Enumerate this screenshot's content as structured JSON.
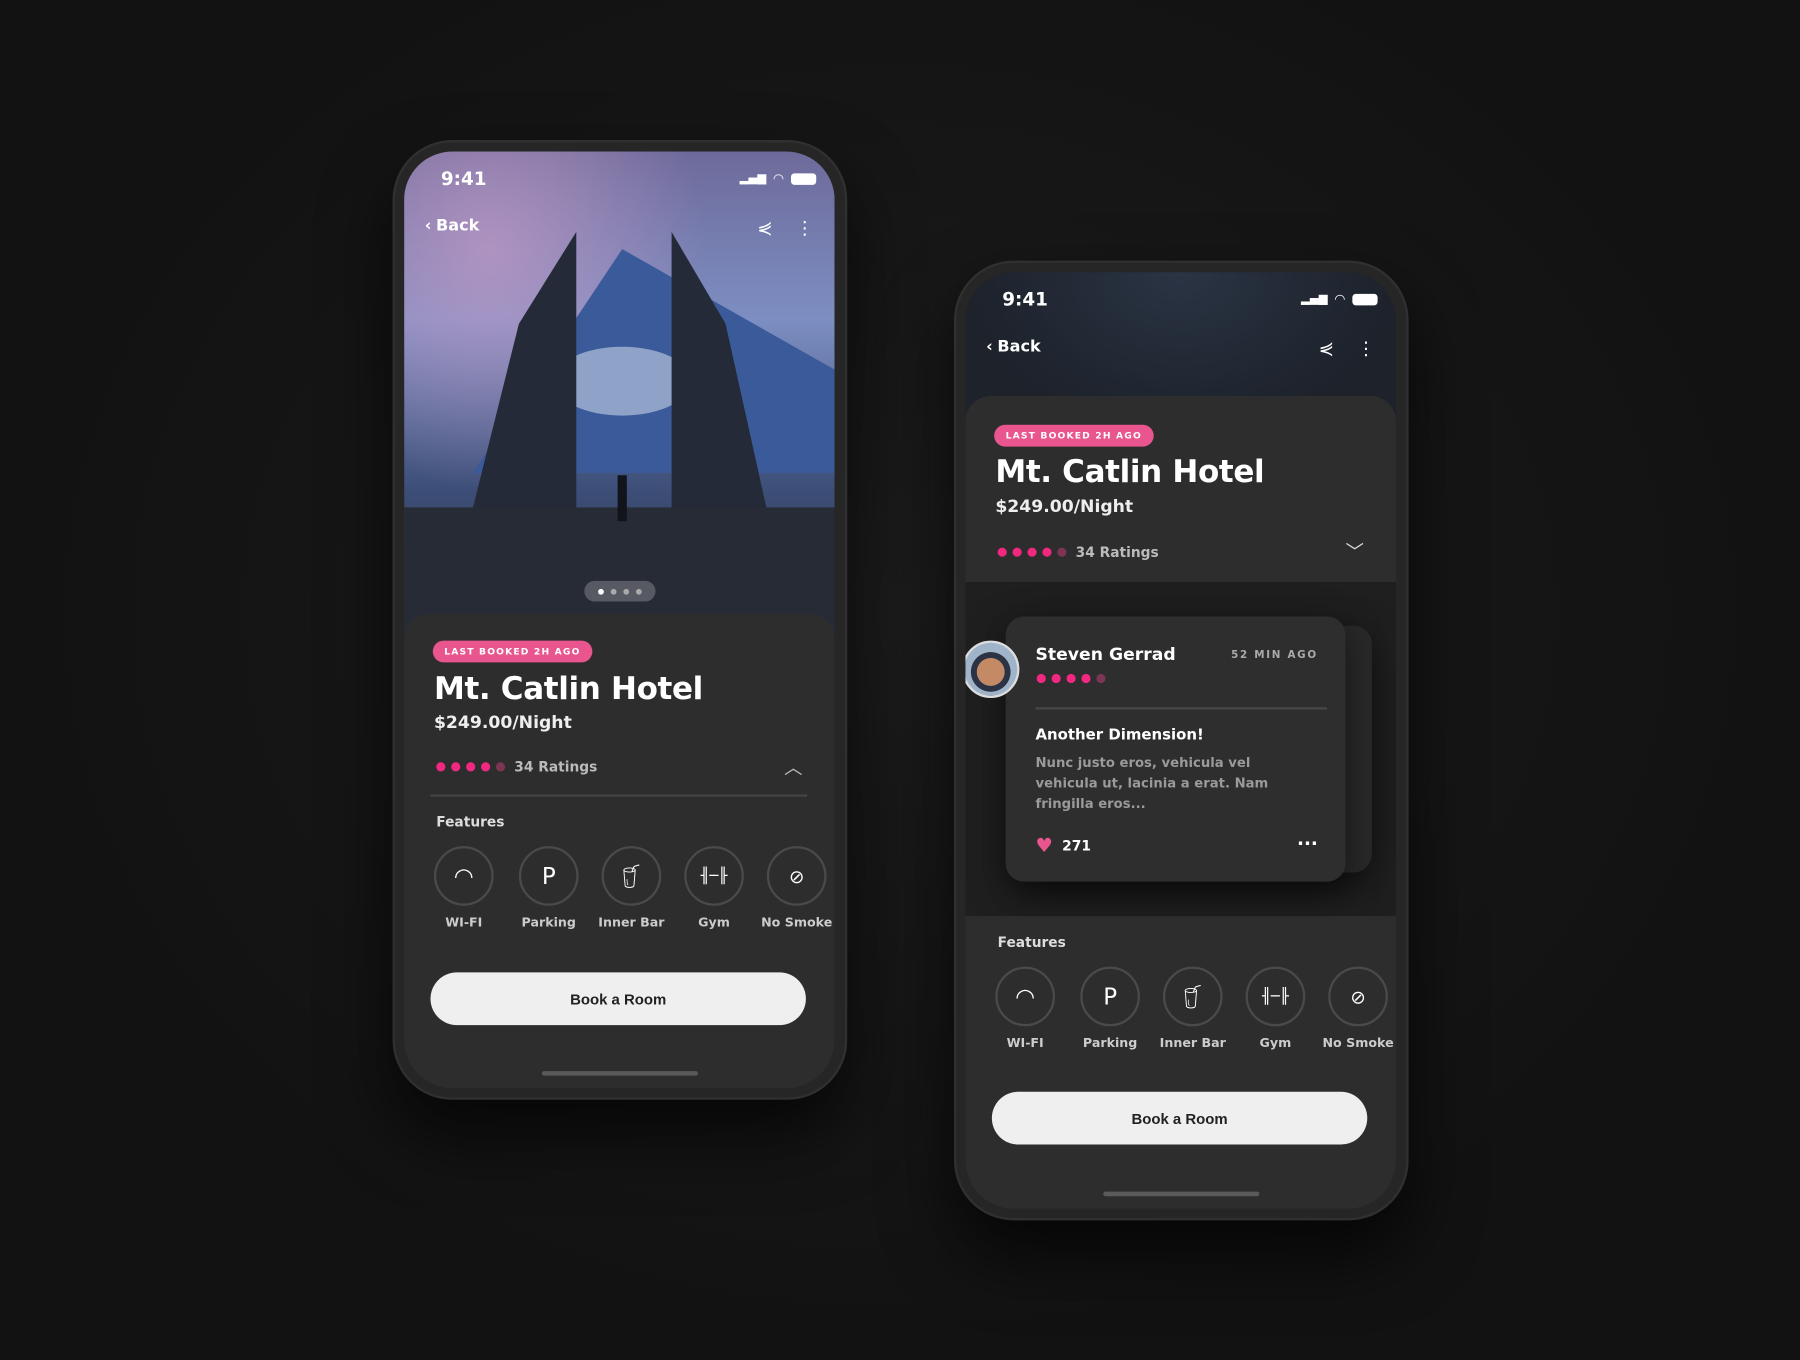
{
  "colors": {
    "accent": "#e8558f",
    "rating_dot": "#f0287f",
    "background": "#141414",
    "sheet": "#2d2d2d",
    "button": "#efefef"
  },
  "status": {
    "time": "9:41",
    "icons": [
      "signal-icon",
      "wifi-icon",
      "battery-icon"
    ]
  },
  "nav": {
    "back": "Back",
    "share_icon": "share-icon",
    "more_icon": "more-vertical-icon"
  },
  "hotel": {
    "badge": "LAST BOOKED 2H AGO",
    "name": "Mt. Catlin Hotel",
    "price": "$249.00/Night",
    "rating": 4,
    "rating_max": 5,
    "ratings_label": "34 Ratings"
  },
  "gallery": {
    "pages": 4,
    "current": 1
  },
  "features": {
    "label": "Features",
    "items": [
      {
        "label": "WI-FI",
        "icon": "wifi-icon"
      },
      {
        "label": "Parking",
        "icon": "parking-icon",
        "glyph": "P"
      },
      {
        "label": "Inner Bar",
        "icon": "drink-icon"
      },
      {
        "label": "Gym",
        "icon": "dumbbell-icon"
      },
      {
        "label": "No Smoke",
        "icon": "no-smoking-icon"
      }
    ]
  },
  "book_button": "Book a Room",
  "review": {
    "author": "Steven Gerrad",
    "time": "52 MIN AGO",
    "rating": 4,
    "title": "Another Dimension!",
    "body": "Nunc justo eros, vehicula vel vehicula ut, lacinia a erat. Nam fringilla eros...",
    "likes": "271"
  }
}
